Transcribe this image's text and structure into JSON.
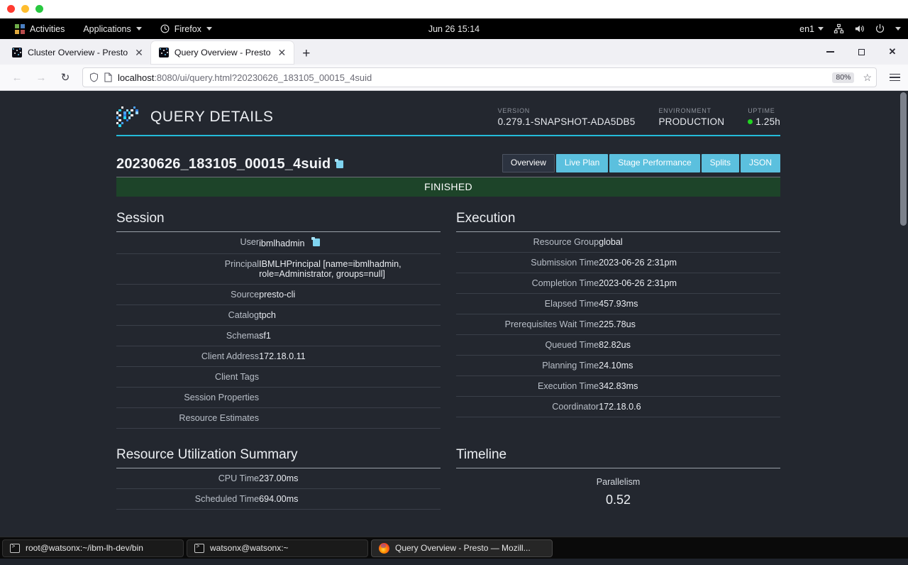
{
  "os": {
    "activities": "Activities",
    "applications": "Applications",
    "firefox_menu": "Firefox",
    "clock": "Jun 26  15:14",
    "keyboard_layout": "en1",
    "tray_icons": [
      "network-icon",
      "volume-icon",
      "power-icon",
      "chevron-down-icon"
    ]
  },
  "browser": {
    "tabs": [
      {
        "title": "Cluster Overview - Presto",
        "active": false
      },
      {
        "title": "Query Overview - Presto",
        "active": true
      }
    ],
    "new_tab_label": "+",
    "url_host": "localhost",
    "url_rest": ":8080/ui/query.html?20230626_183105_00015_4suid",
    "zoom_level": "80%",
    "window_controls": [
      "minimize",
      "maximize",
      "close"
    ]
  },
  "presto": {
    "app_title": "QUERY DETAILS",
    "header_meta": [
      {
        "label": "VERSION",
        "value": "0.279.1-SNAPSHOT-ADA5DB5"
      },
      {
        "label": "ENVIRONMENT",
        "value": "PRODUCTION"
      },
      {
        "label": "UPTIME",
        "value": "1.25h"
      }
    ],
    "query_id": "20230626_183105_00015_4suid",
    "nav_buttons": [
      {
        "label": "Overview",
        "active": true
      },
      {
        "label": "Live Plan",
        "active": false
      },
      {
        "label": "Stage Performance",
        "active": false
      },
      {
        "label": "Splits",
        "active": false
      },
      {
        "label": "JSON",
        "active": false
      }
    ],
    "state": "FINISHED",
    "session": {
      "title": "Session",
      "rows": [
        {
          "key": "User",
          "value": "ibmlhadmin",
          "copy": true
        },
        {
          "key": "Principal",
          "value": "IBMLHPrincipal [name=ibmlhadmin, role=Administrator, groups=null]"
        },
        {
          "key": "Source",
          "value": "presto-cli"
        },
        {
          "key": "Catalog",
          "value": "tpch"
        },
        {
          "key": "Schema",
          "value": "sf1"
        },
        {
          "key": "Client Address",
          "value": "172.18.0.11"
        },
        {
          "key": "Client Tags",
          "value": ""
        },
        {
          "key": "Session Properties",
          "value": ""
        },
        {
          "key": "Resource Estimates",
          "value": ""
        }
      ]
    },
    "execution": {
      "title": "Execution",
      "rows": [
        {
          "key": "Resource Group",
          "value": "global"
        },
        {
          "key": "Submission Time",
          "value": "2023-06-26 2:31pm"
        },
        {
          "key": "Completion Time",
          "value": "2023-06-26 2:31pm"
        },
        {
          "key": "Elapsed Time",
          "value": "457.93ms"
        },
        {
          "key": "Prerequisites Wait Time",
          "value": "225.78us"
        },
        {
          "key": "Queued Time",
          "value": "82.82us"
        },
        {
          "key": "Planning Time",
          "value": "24.10ms"
        },
        {
          "key": "Execution Time",
          "value": "342.83ms"
        },
        {
          "key": "Coordinator",
          "value": "172.18.0.6"
        }
      ]
    },
    "resource_utilization": {
      "title": "Resource Utilization Summary",
      "rows": [
        {
          "key": "CPU Time",
          "value": "237.00ms"
        },
        {
          "key": "Scheduled Time",
          "value": "694.00ms"
        }
      ]
    },
    "timeline": {
      "title": "Timeline",
      "metric_label": "Parallelism",
      "metric_value": "0.52"
    },
    "colors": {
      "accent": "#24bbd9",
      "button": "#5bc0de",
      "state_finished": "#1d4429",
      "page_bg": "#23272f"
    }
  },
  "taskbar": {
    "items": [
      {
        "title": "root@watsonx:~/ibm-lh-dev/bin",
        "icon": "terminal-icon",
        "active": false
      },
      {
        "title": "watsonx@watsonx:~",
        "icon": "terminal-icon",
        "active": false
      },
      {
        "title": "Query Overview - Presto — Mozill...",
        "icon": "firefox-icon",
        "active": true
      }
    ]
  }
}
